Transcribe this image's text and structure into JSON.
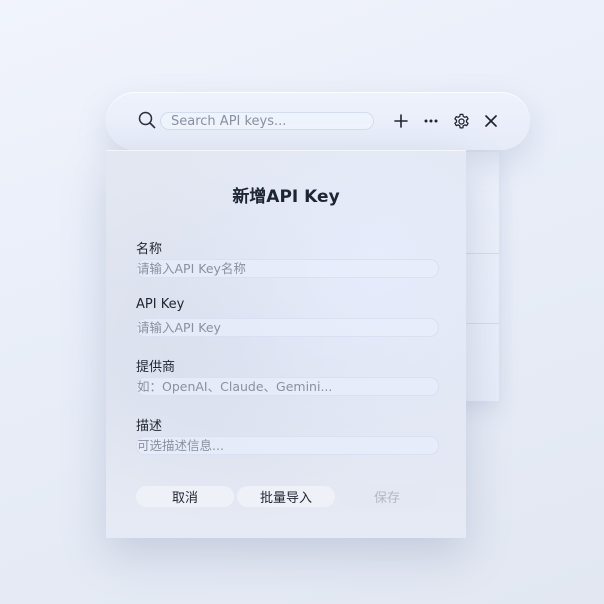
{
  "toolbar": {
    "search": {
      "placeholder": "Search API keys...",
      "value": ""
    },
    "icons": [
      "search-icon",
      "plus-icon",
      "more-icon",
      "gear-icon",
      "close-icon"
    ]
  },
  "dialog": {
    "title": "新增API Key",
    "fields": {
      "name": {
        "label": "名称",
        "placeholder": "请输入API Key名称"
      },
      "api_key": {
        "label": "API Key",
        "placeholder": "请输入API Key"
      },
      "provider": {
        "label": "提供商",
        "placeholder": "如：OpenAI、Claude、Gemini..."
      },
      "description": {
        "label": "描述",
        "placeholder": "可选描述信息..."
      }
    },
    "buttons": {
      "cancel": "取消",
      "batch_import": "批量导入",
      "save": "保存"
    }
  },
  "colors": {
    "background": "#e9eef9",
    "text": "#1f2430",
    "placeholder": "#8b909c",
    "disabled": "#b4b8c2"
  }
}
